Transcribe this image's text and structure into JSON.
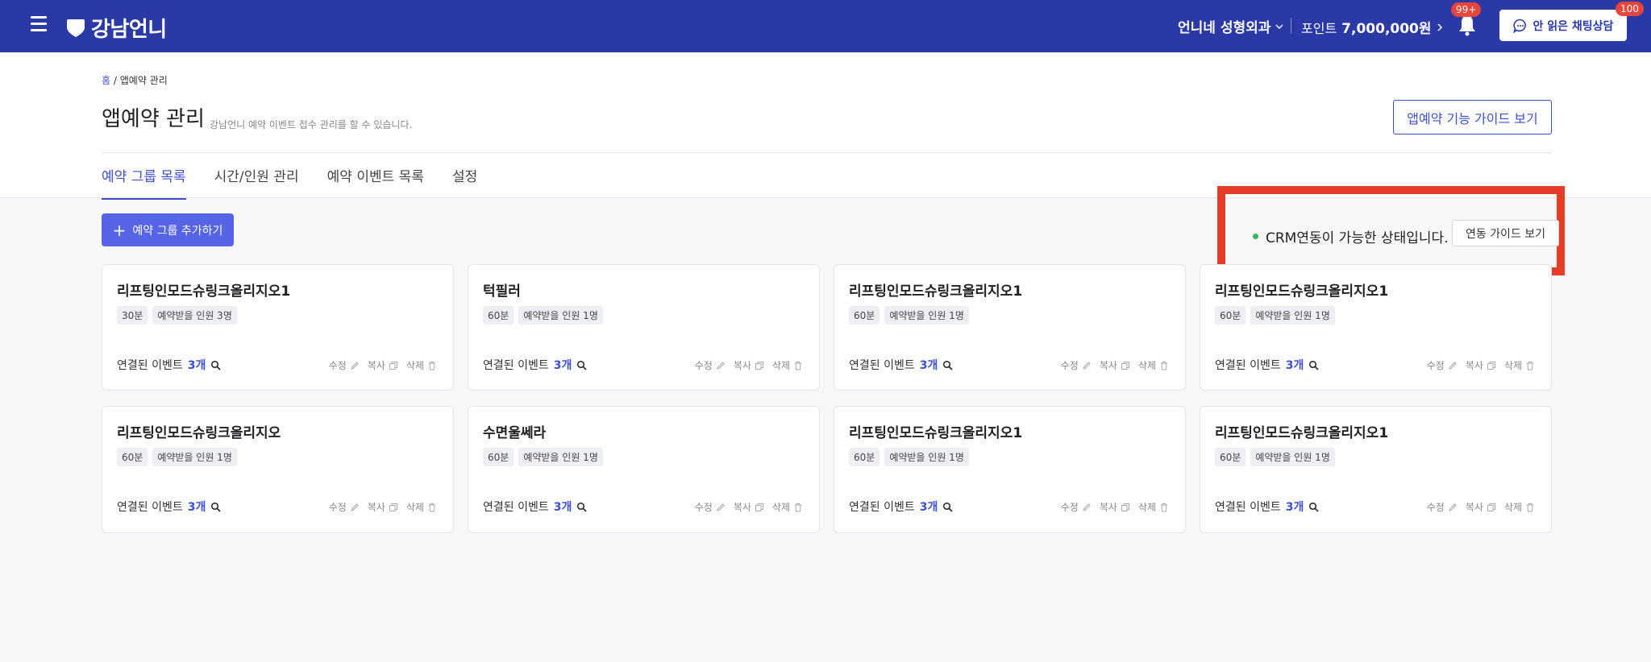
{
  "topbar": {
    "brand": "강남언니",
    "hospital": "언니네 성형외과",
    "points_label": "포인트",
    "points_value": "7,000,000원",
    "bell_badge": "99+",
    "chat_label": "안 읽은 채팅상담",
    "chat_badge": "100"
  },
  "breadcrumb": {
    "home": "홈",
    "sep": "/",
    "current": "앱예약 관리"
  },
  "page": {
    "title": "앱예약 관리",
    "description": "강남언니 예약 이벤트 접수 관리를 할 수 있습니다.",
    "guide_button": "앱예약 기능 가이드 보기"
  },
  "tabs": [
    "예약 그룹 목록",
    "시간/인원 관리",
    "예약 이벤트 목록",
    "설정"
  ],
  "add_group_button": "예약 그룹 추가하기",
  "crm": {
    "status": "CRM연동이 가능한 상태입니다.",
    "guide_button": "연동 가이드 보기",
    "status_color": "#3cb55d"
  },
  "card_labels": {
    "events": "연결된 이벤트",
    "edit": "수정",
    "copy": "복사",
    "delete": "삭제"
  },
  "cards": [
    {
      "title": "리프팅인모드슈링크올리지오1",
      "duration": "30분",
      "capacity": "예약받을 인원 3명",
      "events": "3개"
    },
    {
      "title": "턱필러",
      "duration": "60분",
      "capacity": "예약받을 인원 1명",
      "events": "3개"
    },
    {
      "title": "리프팅인모드슈링크올리지오1",
      "duration": "60분",
      "capacity": "예약받을 인원 1명",
      "events": "3개"
    },
    {
      "title": "리프팅인모드슈링크올리지오1",
      "duration": "60분",
      "capacity": "예약받을 인원 1명",
      "events": "3개"
    },
    {
      "title": "리프팅인모드슈링크올리지오",
      "duration": "60분",
      "capacity": "예약받을 인원 1명",
      "events": "3개"
    },
    {
      "title": "수면울쎄라",
      "duration": "60분",
      "capacity": "예약받을 인원 1명",
      "events": "3개"
    },
    {
      "title": "리프팅인모드슈링크올리지오1",
      "duration": "60분",
      "capacity": "예약받을 인원 1명",
      "events": "3개"
    },
    {
      "title": "리프팅인모드슈링크올리지오1",
      "duration": "60분",
      "capacity": "예약받을 인원 1명",
      "events": "3개"
    }
  ],
  "colors": {
    "topbar": "#2a39a6",
    "accent": "#3d4fcf",
    "highlight_border": "#e53d27"
  }
}
